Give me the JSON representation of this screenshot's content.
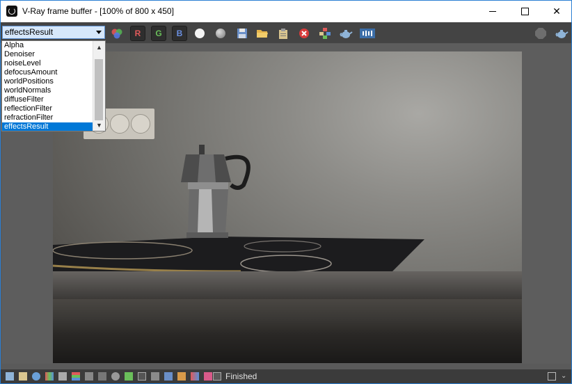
{
  "window": {
    "title": "V-Ray frame buffer - [100% of 800 x 450]"
  },
  "toolbar": {
    "channel_select_value": "effectsResult",
    "channel_buttons": [
      "R",
      "G",
      "B"
    ]
  },
  "channel_list": {
    "options": [
      "Alpha",
      "Denoiser",
      "noiseLevel",
      "defocusAmount",
      "worldPositions",
      "worldNormals",
      "diffuseFilter",
      "reflectionFilter",
      "refractionFilter",
      "effectsResult"
    ],
    "selected": "effectsResult"
  },
  "statusbar": {
    "text": "Finished"
  },
  "icons": [
    "vray-logo-icon",
    "minimize-icon",
    "maximize-icon",
    "close-icon",
    "color-channels-icon",
    "white-dot-icon",
    "gray-dot-icon",
    "save-icon",
    "open-folder-icon",
    "clipboard-icon",
    "clear-icon",
    "region-render-icon",
    "teapot-render-icon",
    "history-icon",
    "stop-icon",
    "teapot-icon"
  ],
  "colors": {
    "accent": "#0078d7",
    "background": "#444444"
  }
}
